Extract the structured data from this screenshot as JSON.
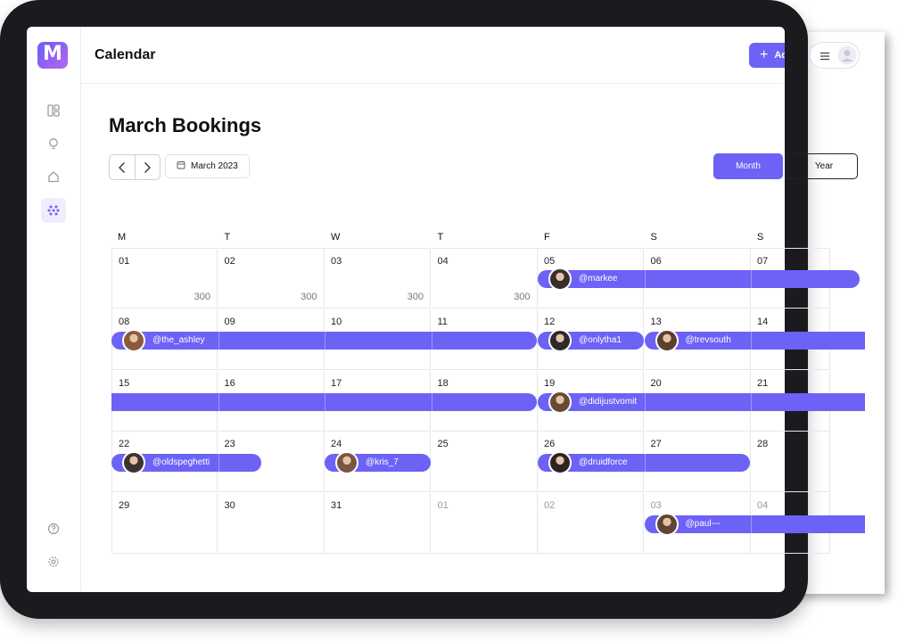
{
  "app": {
    "logo_letter": "M",
    "title": "Calendar"
  },
  "header": {
    "add_button": "Add a propert",
    "menu_icon": "hamburger-icon",
    "avatar_icon": "user-avatar-icon"
  },
  "page": {
    "title": "March Bookings",
    "month_label": "March 2023",
    "view_month": "Month",
    "view_year": "Year"
  },
  "sidebar": {
    "icons": [
      "layout-icon",
      "lightbulb-icon",
      "home-icon",
      "dots-grid-icon",
      "help-icon",
      "settings-icon"
    ],
    "active": "dots-grid-icon"
  },
  "weekdays": [
    "M",
    "T",
    "W",
    "T",
    "F",
    "S",
    "S"
  ],
  "weeks": [
    [
      {
        "d": "01",
        "p": "300"
      },
      {
        "d": "02",
        "p": "300"
      },
      {
        "d": "03",
        "p": "300"
      },
      {
        "d": "04",
        "p": "300"
      },
      {
        "d": "05"
      },
      {
        "d": "06"
      },
      {
        "d": "07"
      }
    ],
    [
      {
        "d": "08"
      },
      {
        "d": "09"
      },
      {
        "d": "10"
      },
      {
        "d": "11"
      },
      {
        "d": "12"
      },
      {
        "d": "13"
      },
      {
        "d": "14"
      }
    ],
    [
      {
        "d": "15"
      },
      {
        "d": "16"
      },
      {
        "d": "17"
      },
      {
        "d": "18"
      },
      {
        "d": "19"
      },
      {
        "d": "20"
      },
      {
        "d": "21"
      }
    ],
    [
      {
        "d": "22"
      },
      {
        "d": "23"
      },
      {
        "d": "24"
      },
      {
        "d": "25"
      },
      {
        "d": "26"
      },
      {
        "d": "27"
      },
      {
        "d": "28"
      }
    ],
    [
      {
        "d": "29"
      },
      {
        "d": "30"
      },
      {
        "d": "31"
      },
      {
        "d": "01",
        "m": true
      },
      {
        "d": "02",
        "m": true
      },
      {
        "d": "03",
        "m": true
      },
      {
        "d": "04",
        "m": true
      }
    ]
  ],
  "bookings": [
    {
      "user": "@markee",
      "week": 0,
      "start": 4,
      "end": 6,
      "round_left": true,
      "round_right": true,
      "color": "#6c62f5"
    },
    {
      "user": "@the_ashley",
      "week": 1,
      "start": 0,
      "end": 3,
      "round_left": true,
      "round_right": true,
      "color": "#6c62f5"
    },
    {
      "user": "@onlytha1",
      "week": 1,
      "start": 4,
      "end": 4,
      "round_left": true,
      "round_right": true,
      "color": "#6c62f5"
    },
    {
      "user": "@trevsouth",
      "week": 1,
      "start": 5,
      "end": 6,
      "round_left": true,
      "round_right": false,
      "color": "#6c62f5"
    },
    {
      "user": "",
      "week": 2,
      "start": 0,
      "end": 3,
      "round_left": false,
      "round_right": true,
      "color": "#6c62f5"
    },
    {
      "user": "@didijustvomit",
      "week": 2,
      "start": 4,
      "end": 6,
      "round_left": true,
      "round_right": false,
      "color": "#6c62f5"
    },
    {
      "user": "@oldspeghetti",
      "week": 3,
      "start": 0,
      "end": 1,
      "round_left": true,
      "round_right": true,
      "color": "#6c62f5"
    },
    {
      "user": "@kris_7",
      "week": 3,
      "start": 2,
      "end": 2,
      "round_left": true,
      "round_right": true,
      "color": "#6c62f5"
    },
    {
      "user": "@druidforce",
      "week": 3,
      "start": 4,
      "end": 5,
      "round_left": true,
      "round_right": true,
      "color": "#6c62f5"
    },
    {
      "user": "@paul---",
      "week": 4,
      "start": 5,
      "end": 6,
      "round_left": true,
      "round_right": false,
      "color": "#6c62f5"
    }
  ]
}
